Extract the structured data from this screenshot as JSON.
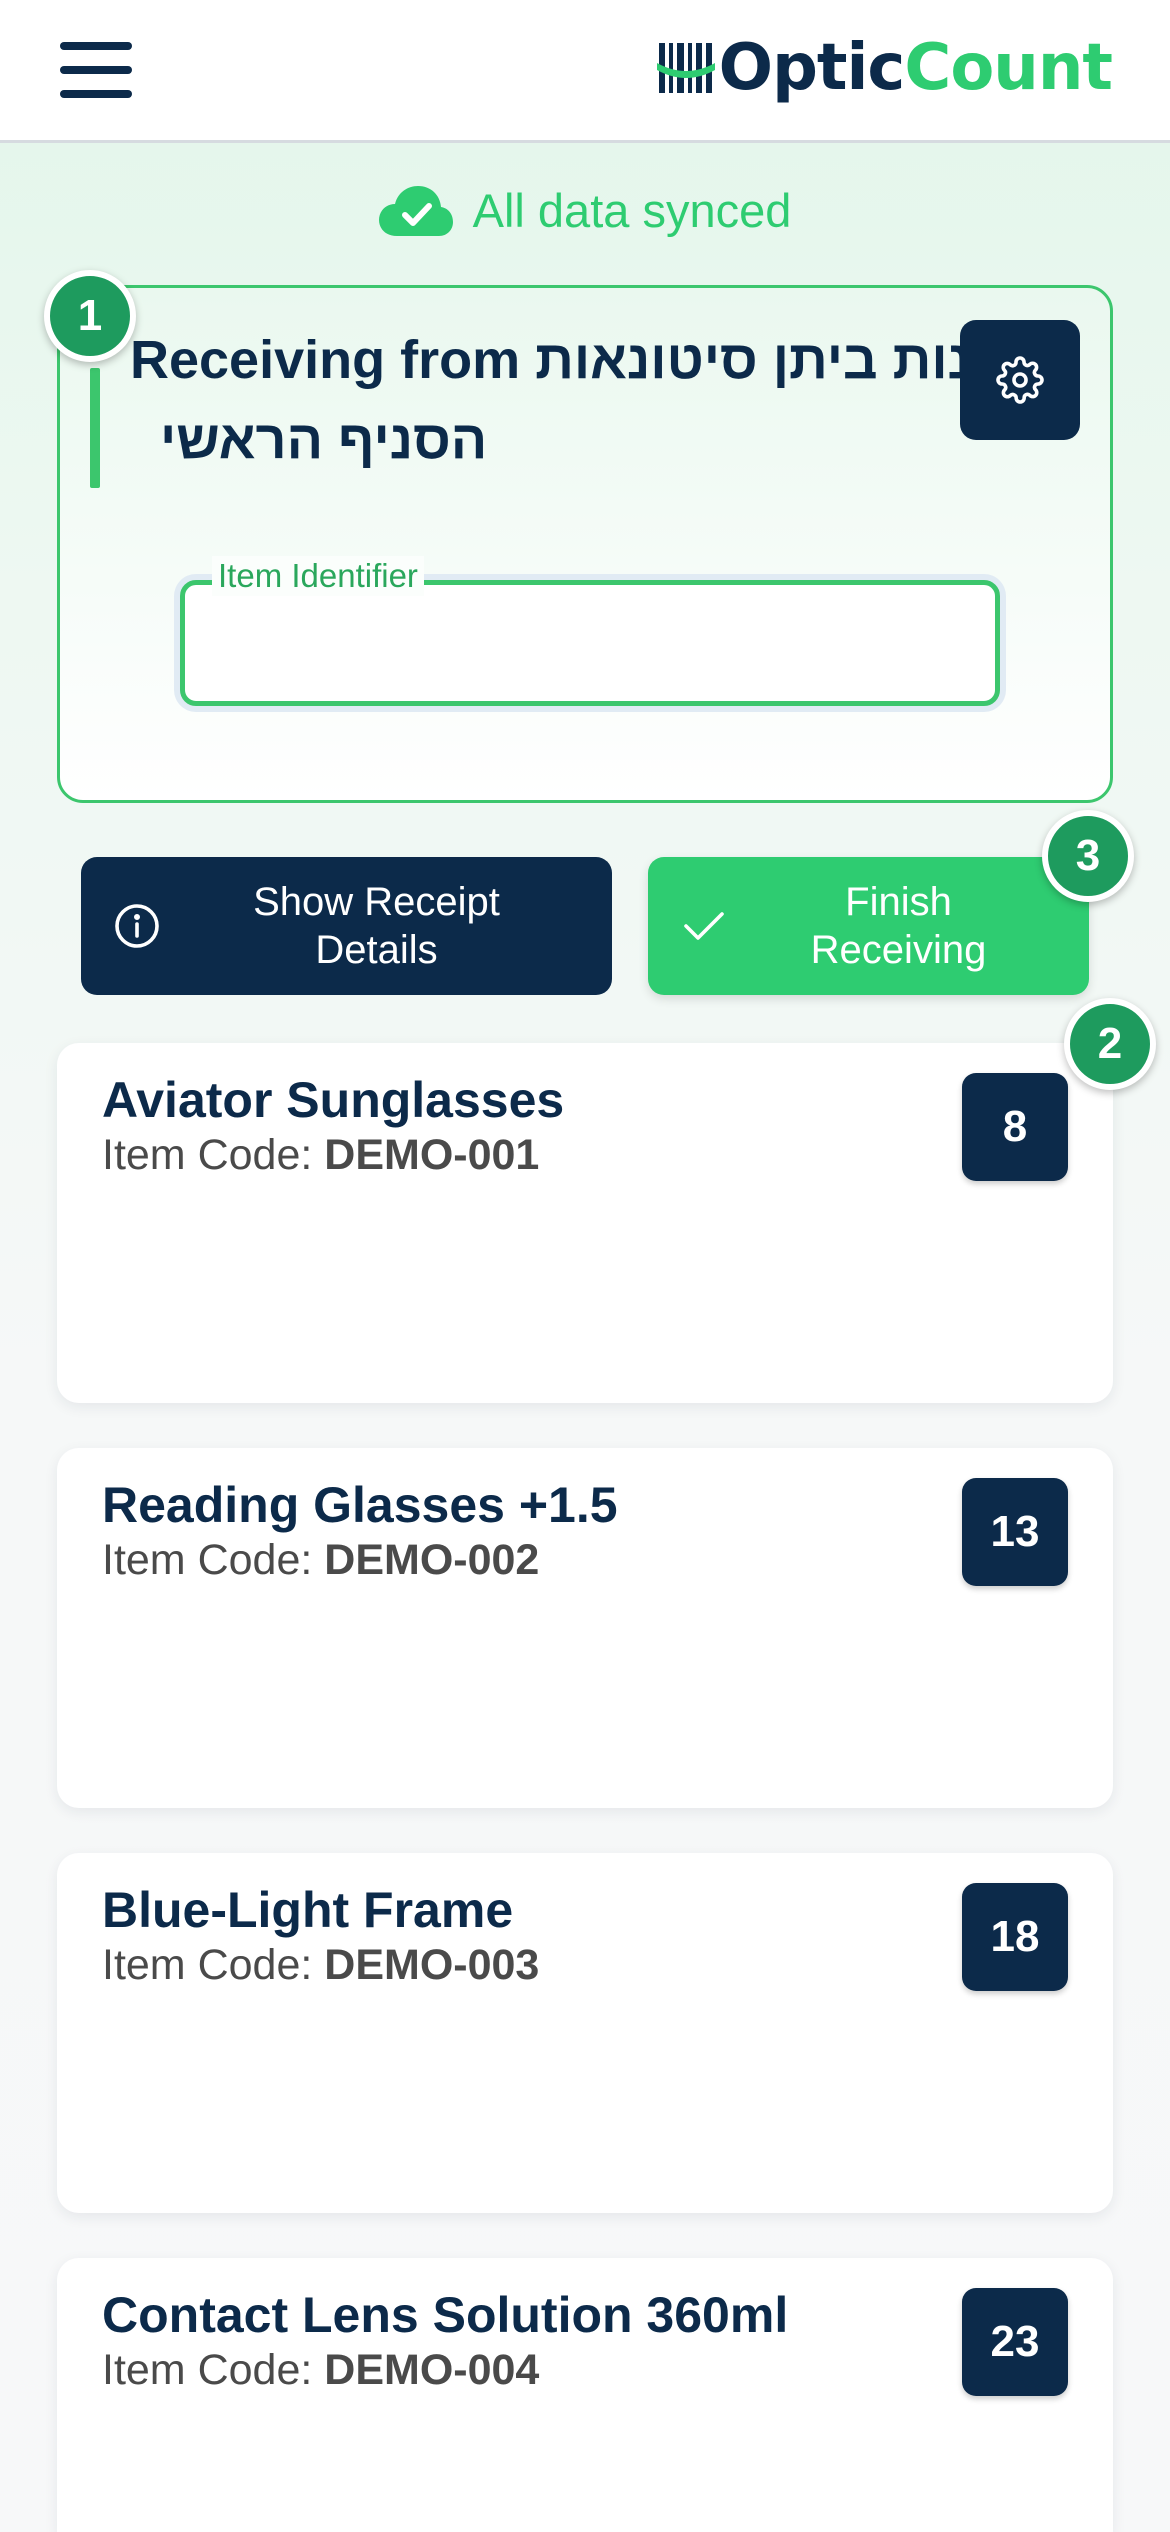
{
  "header": {
    "logo_optic": "Optic",
    "logo_count": "Count"
  },
  "sync": {
    "text": "All data synced"
  },
  "receiving": {
    "title_line1": "Receiving from נות ביתן סיטונאות",
    "title_line2": "הסניף הראשי",
    "field_label": "Item Identifier",
    "field_value": ""
  },
  "badges": {
    "one": "1",
    "two": "2",
    "three": "3"
  },
  "actions": {
    "receipt_label_1": "Show Receipt",
    "receipt_label_2": "Details",
    "finish_label_1": "Finish",
    "finish_label_2": "Receiving"
  },
  "items": [
    {
      "name": "Aviator Sunglasses",
      "code_label": "Item Code: ",
      "code": "DEMO-001",
      "qty": "8"
    },
    {
      "name": "Reading Glasses +1.5",
      "code_label": "Item Code: ",
      "code": "DEMO-002",
      "qty": "13"
    },
    {
      "name": "Blue-Light Frame",
      "code_label": "Item Code: ",
      "code": "DEMO-003",
      "qty": "18"
    },
    {
      "name": "Contact Lens Solution 360ml",
      "code_label": "Item Code: ",
      "code": "DEMO-004",
      "qty": "23"
    }
  ],
  "colors": {
    "navy": "#0c2a4a",
    "green": "#2ecc71",
    "badge_green": "#1e9b5e"
  },
  "icons": [
    "menu-icon",
    "barcode-icon",
    "cloud-check-icon",
    "gear-icon",
    "info-icon",
    "check-icon"
  ]
}
